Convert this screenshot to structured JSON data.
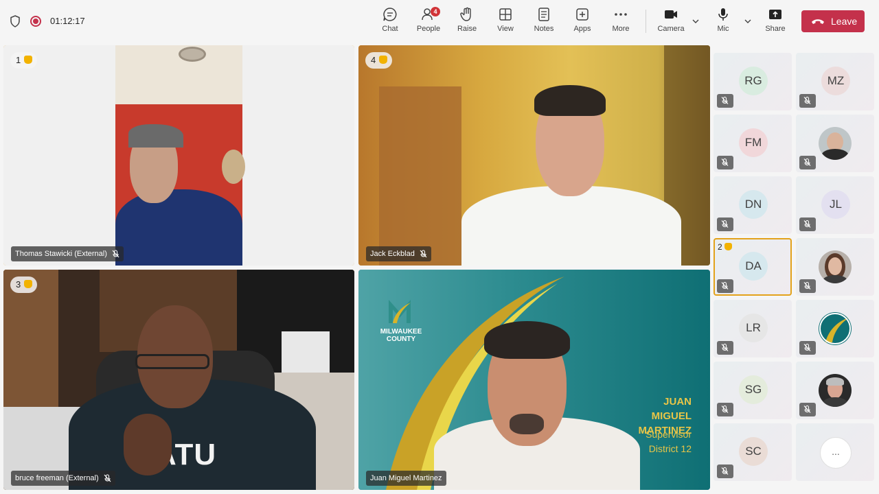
{
  "meeting": {
    "elapsed_time": "01:12:17"
  },
  "toolbar": {
    "chat": "Chat",
    "people": "People",
    "people_count": "4",
    "raise": "Raise",
    "view": "View",
    "notes": "Notes",
    "apps": "Apps",
    "more": "More",
    "camera": "Camera",
    "mic": "Mic",
    "share": "Share",
    "leave": "Leave"
  },
  "video_tiles": [
    {
      "name": "Thomas Stawicki (External)",
      "hand_order": "1",
      "muted": true
    },
    {
      "name": "Jack Eckblad",
      "hand_order": "4",
      "muted": true
    },
    {
      "name": "bruce freeman (External)",
      "hand_order": "3",
      "muted": true
    },
    {
      "name": "Juan Miguel Martinez",
      "muted": false,
      "background": {
        "logo_text": "MILWAUKEE COUNTY",
        "name_text": "JUAN MIGUEL MARTINEZ",
        "title_line1": "Supervisor",
        "title_line2": "District 12"
      },
      "shirt_text": "ATU"
    }
  ],
  "bruce_shirt": "ATU",
  "participants": [
    {
      "initials": "RG",
      "muted": true
    },
    {
      "initials": "MZ",
      "muted": true
    },
    {
      "initials": "FM",
      "muted": true
    },
    {
      "photo": "bald-man-photo",
      "muted": true
    },
    {
      "initials": "DN",
      "muted": true
    },
    {
      "initials": "JL",
      "muted": true
    },
    {
      "initials": "DA",
      "hand_order": "2",
      "muted": true
    },
    {
      "photo": "woman-photo",
      "muted": true
    },
    {
      "initials": "LR",
      "muted": true
    },
    {
      "photo": "milwaukee-county-logo",
      "muted": true
    },
    {
      "initials": "SG",
      "muted": true
    },
    {
      "photo": "gray-haired-man-photo",
      "muted": true
    },
    {
      "initials": "SC",
      "muted": true
    }
  ],
  "overflow_label": "..."
}
